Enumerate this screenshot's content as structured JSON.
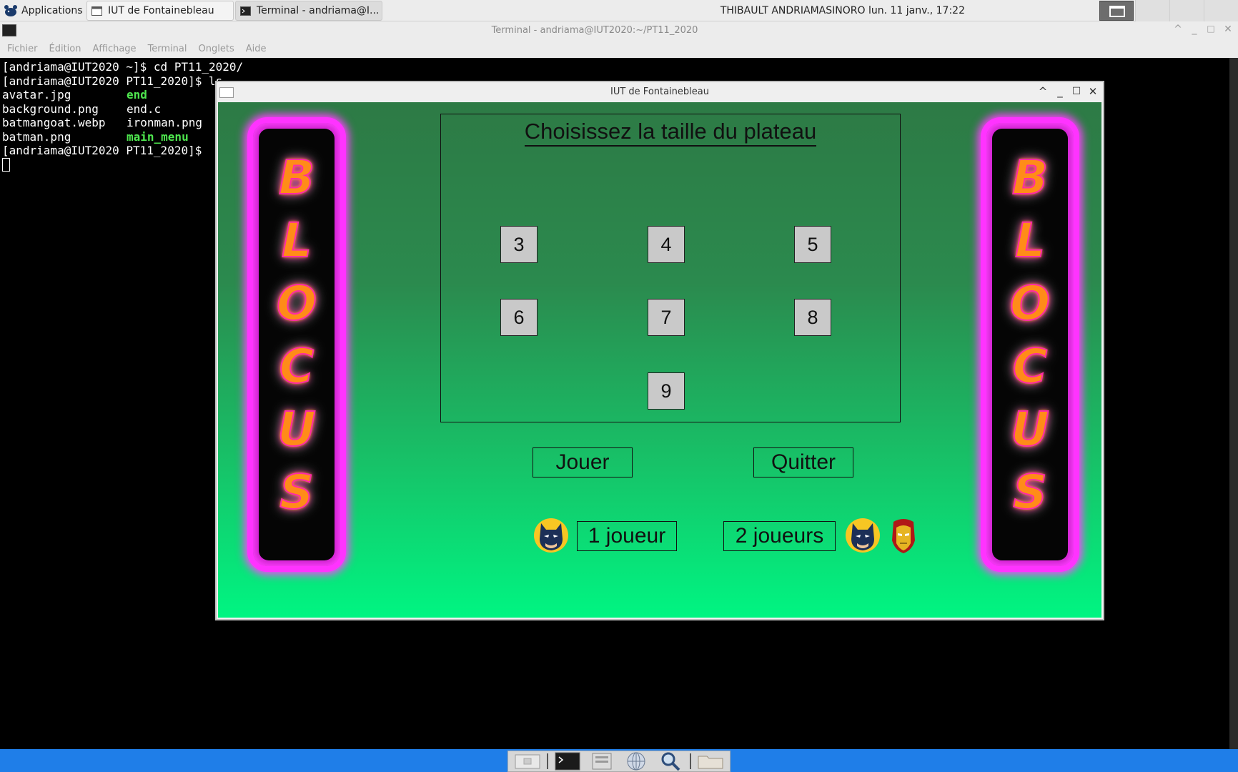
{
  "top_panel": {
    "apps_label": "Applications",
    "tasks": [
      {
        "label": "IUT de Fontainebleau"
      },
      {
        "label": "Terminal - andriama@I..."
      }
    ],
    "clock": "THIBAULT ANDRIAMASINORO lun. 11 janv., 17:22"
  },
  "terminal": {
    "title": "Terminal - andriama@IUT2020:~/PT11_2020",
    "menu": [
      "Fichier",
      "Édition",
      "Affichage",
      "Terminal",
      "Onglets",
      "Aide"
    ],
    "lines": {
      "l1": "[andriama@IUT2020 ~]$ cd PT11_2020/",
      "l2": "[andriama@IUT2020 PT11_2020]$ ls",
      "f1a": "avatar.jpg",
      "f1b": "end",
      "f2a": "background.png",
      "f2b": "end.c",
      "f3a": "batmangoat.webp",
      "f3b": "ironman.png",
      "f4a": "batman.png",
      "f4b": "main_menu",
      "l7": "[andriama@IUT2020 PT11_2020]$"
    }
  },
  "game": {
    "window_title": "IUT de Fontainebleau",
    "logo_letters": [
      "B",
      "L",
      "O",
      "C",
      "U",
      "S"
    ],
    "board_title": "Choisissez la taille du plateau",
    "sizes": [
      "3",
      "4",
      "5",
      "6",
      "7",
      "8",
      "9"
    ],
    "play_label": "Jouer",
    "quit_label": "Quitter",
    "one_player_label": "1 joueur",
    "two_players_label": "2 joueurs"
  },
  "colors": {
    "neon_border": "#ff33ff",
    "letter_fill": "#ff8c18",
    "bottom_bar": "#1f7ee8"
  }
}
